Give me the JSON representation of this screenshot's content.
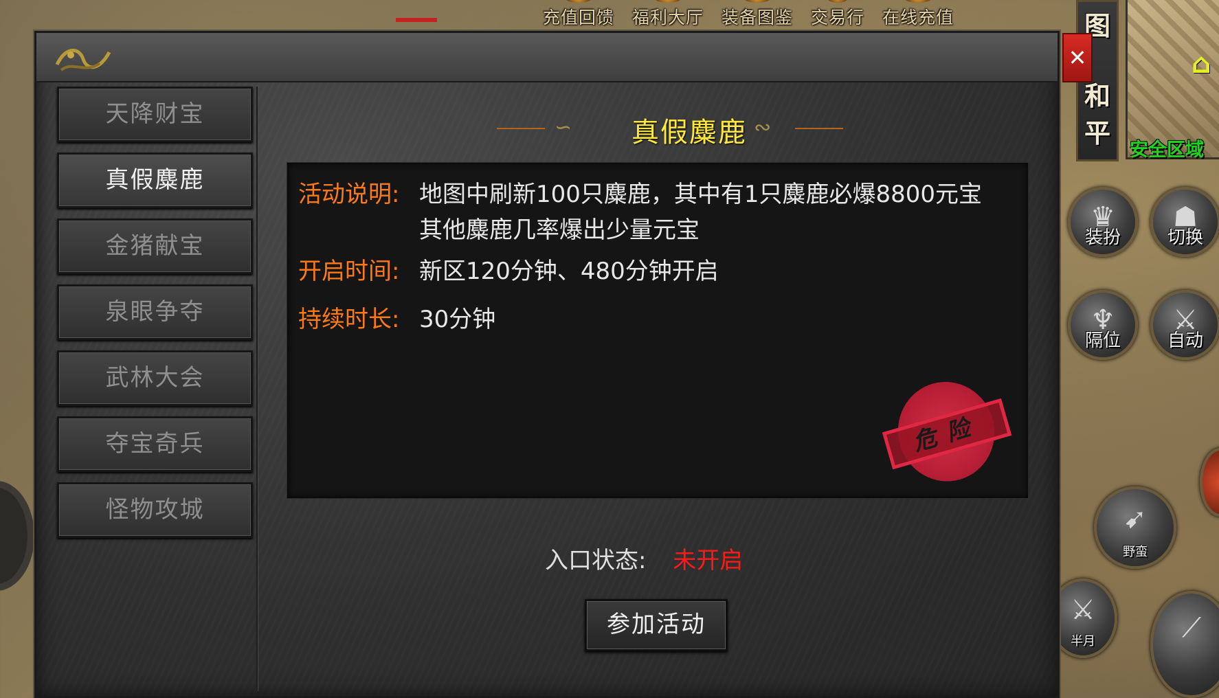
{
  "top_menu": [
    "充值回馈",
    "福利大厅",
    "装备图鉴",
    "交易行",
    "在线充值"
  ],
  "hud": {
    "map_tabs": [
      "图",
      "和",
      "平"
    ],
    "safe_zone": "安全区域",
    "skills": [
      {
        "label": "装扮",
        "icon": "costume-icon"
      },
      {
        "label": "切换",
        "icon": "switch-icon"
      },
      {
        "label": "隔位",
        "icon": "position-icon"
      },
      {
        "label": "自动",
        "icon": "auto-icon"
      },
      {
        "label": "野蛮",
        "icon": "savage-icon"
      },
      {
        "label": "半月",
        "icon": "halfmoon-icon"
      }
    ]
  },
  "panel": {
    "title": "真假麋鹿",
    "close_label": "✕",
    "sidebar": [
      {
        "label": "天降财宝",
        "active": false
      },
      {
        "label": "真假麋鹿",
        "active": true
      },
      {
        "label": "金猪献宝",
        "active": false
      },
      {
        "label": "泉眼争夺",
        "active": false
      },
      {
        "label": "武林大会",
        "active": false
      },
      {
        "label": "夺宝奇兵",
        "active": false
      },
      {
        "label": "怪物攻城",
        "active": false
      }
    ],
    "info": {
      "desc_label": "活动说明:",
      "desc_line1": "地图中刷新100只麋鹿，其中有1只麋鹿必爆8800元宝",
      "desc_line2": "其他麋鹿几率爆出少量元宝",
      "open_label": "开启时间:",
      "open_value": "新区120分钟、480分钟开启",
      "duration_label": "持续时长:",
      "duration_value": "30分钟"
    },
    "stamp_text": "危险",
    "entry_status_label": "入口状态:",
    "entry_status_value": "未开启",
    "join_button": "参加活动"
  },
  "colors": {
    "title": "#ffe83a",
    "label_orange": "#ff7a16",
    "status_red": "#ff1a1a",
    "safe_green": "#1fd51f",
    "close_red": "#d92a24"
  }
}
